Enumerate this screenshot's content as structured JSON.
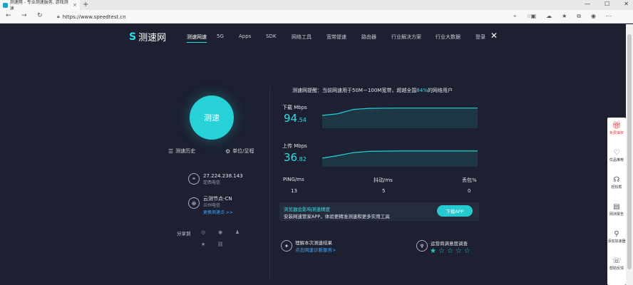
{
  "browser": {
    "tab_title": "测速网 - 专业测速服务, 游戏测速",
    "tab_close": "×",
    "new_tab": "+",
    "url": "https://www.speedtest.cn",
    "window_controls": [
      "—",
      "☐",
      "✕"
    ]
  },
  "header": {
    "logo_text": "测速网",
    "menu": [
      "测速网速",
      "5G",
      "Apps",
      "SDK",
      "网络工具",
      "宽带提速",
      "路由器",
      "行业解决方案",
      "行业大数据",
      "登录"
    ],
    "active_menu_index": 0
  },
  "left": {
    "speed_button": "测速",
    "history_link": "测速历史",
    "unit_link": "单位/显程",
    "ip": "27.224.238.143",
    "ip_location": "定西电信",
    "node_name": "云测节点-CN",
    "node_location": "兰州电信",
    "change_node": "更换测速点 >>",
    "share_label": "分享到"
  },
  "right": {
    "tip_prefix": "测速网提醒：当前网速用于50M－100M宽带，超越全国",
    "tip_percent": "84%",
    "tip_suffix": "的网络用户",
    "download_label": "下载 Mbps",
    "download_int": "94",
    "download_dec": ".54",
    "upload_label": "上传 Mbps",
    "upload_int": "36",
    "upload_dec": ".82",
    "ping_label": "PING/ms",
    "ping_value": "13",
    "jitter_label": "抖动/ms",
    "jitter_value": "5",
    "loss_label": "丢包%",
    "loss_value": "0",
    "banner_title": "浏览器会影响测速精度",
    "banner_text": "安装网速管家APP，体验更精准测速和更多实用工具",
    "download_app": "下载APP",
    "explain_title": "理解本次测速结果",
    "explain_link": "点击网速诊断服务>",
    "survey_title": "运营商满意度调查",
    "rating": 1,
    "rating_max": 5
  },
  "float_toolbar": [
    "免费抽奖",
    "优品推荐",
    "轻松帮",
    "网测报告",
    "添加加速器",
    "帮助反馈"
  ],
  "colors": {
    "accent": "#26d2d8",
    "background": "#1c2030",
    "link": "#41a6ff"
  },
  "chart_data": [
    {
      "type": "line",
      "title": "下载 Mbps",
      "xlabel": "",
      "ylabel": "",
      "x": [
        0,
        1,
        2,
        3,
        4,
        5,
        6,
        7,
        8,
        9,
        10
      ],
      "series": [
        {
          "values": [
            60,
            68,
            88,
            93,
            94,
            94.5,
            94.5,
            94.5,
            94.5,
            94.5,
            94.5
          ]
        }
      ],
      "ylim": [
        0,
        120
      ]
    },
    {
      "type": "line",
      "title": "上传 Mbps",
      "xlabel": "",
      "ylabel": "",
      "x": [
        0,
        1,
        2,
        3,
        4,
        5,
        6,
        7,
        8,
        9,
        10
      ],
      "series": [
        {
          "values": [
            20,
            26,
            33,
            36,
            36.5,
            36.8,
            36.8,
            36.8,
            36.8,
            36.8,
            36.8
          ]
        }
      ],
      "ylim": [
        0,
        60
      ]
    }
  ]
}
